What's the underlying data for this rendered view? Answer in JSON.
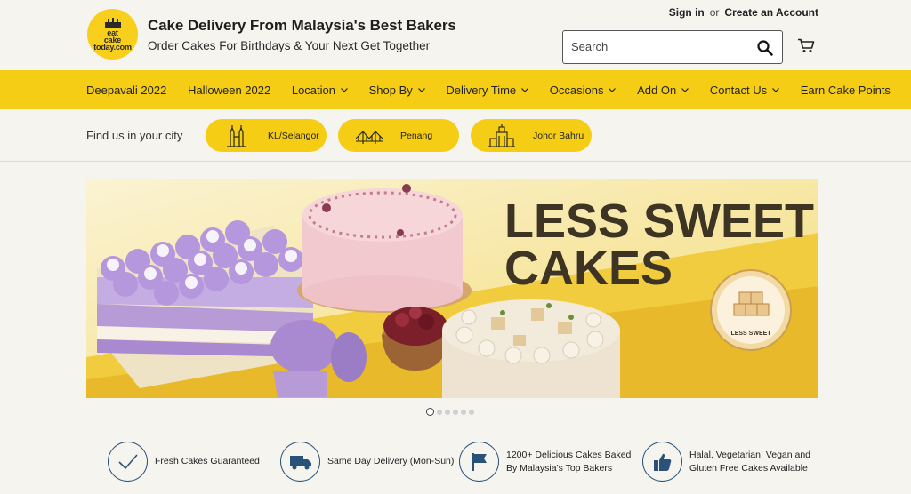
{
  "header": {
    "logo_lines": [
      "eat",
      "cake",
      "today.com"
    ],
    "title": "Cake Delivery From Malaysia's Best Bakers",
    "subtitle": "Order Cakes For Birthdays & Your Next Get Together",
    "sign_in": "Sign in",
    "or": "or",
    "create_account": "Create an Account",
    "search_placeholder": "Search"
  },
  "nav": {
    "items": [
      {
        "label": "Deepavali 2022",
        "dropdown": false
      },
      {
        "label": "Halloween 2022",
        "dropdown": false
      },
      {
        "label": "Location",
        "dropdown": true
      },
      {
        "label": "Shop By",
        "dropdown": true
      },
      {
        "label": "Delivery Time",
        "dropdown": true
      },
      {
        "label": "Occasions",
        "dropdown": true
      },
      {
        "label": "Add On",
        "dropdown": true
      },
      {
        "label": "Contact Us",
        "dropdown": true
      },
      {
        "label": "Earn Cake Points",
        "dropdown": false
      }
    ]
  },
  "cities": {
    "label": "Find us in your city",
    "items": [
      "KL/Selangor",
      "Penang",
      "Johor Bahru"
    ]
  },
  "banner": {
    "headline_line1": "LESS SWEET",
    "headline_line2": "CAKES",
    "badge": "LESS SWEET",
    "slides": 6,
    "active_slide": 1
  },
  "features": [
    {
      "icon": "check-icon",
      "line1": "Fresh Cakes Guaranteed",
      "line2": ""
    },
    {
      "icon": "truck-icon",
      "line1": "Same Day Delivery (Mon-Sun)",
      "line2": ""
    },
    {
      "icon": "flag-icon",
      "line1": "1200+ Delicious Cakes Baked",
      "line2": "By Malaysia's Top Bakers"
    },
    {
      "icon": "thumbs-up-icon",
      "line1": "Halal, Vegetarian, Vegan and",
      "line2": "Gluten Free Cakes Available"
    }
  ],
  "colors": {
    "brand_yellow": "#f5cd14",
    "background": "#f5f4ef",
    "feature_icon": "#2a5278",
    "banner_text": "#3d3424"
  }
}
